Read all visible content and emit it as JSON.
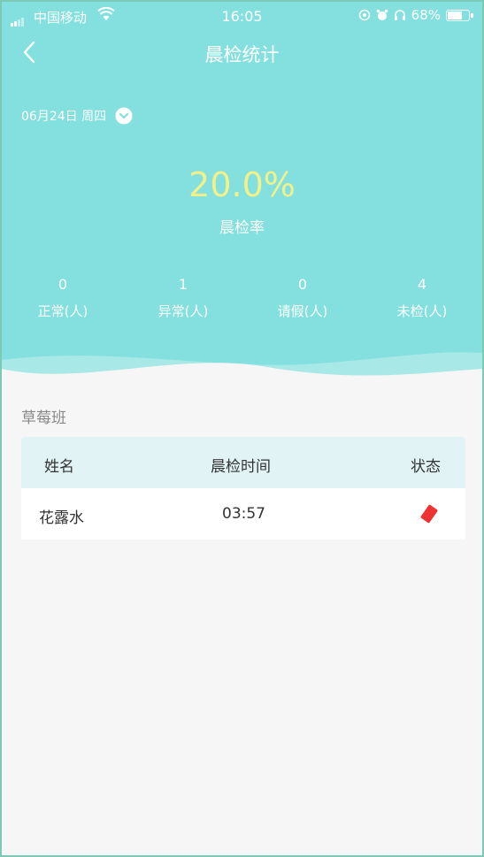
{
  "status_bar": {
    "carrier": "中国移动",
    "time": "16:05",
    "battery": "68%",
    "battery_level": 0.68
  },
  "nav": {
    "title": "晨检统计"
  },
  "date_selector": {
    "label": "06月24日 周四"
  },
  "summary": {
    "rate": "20.0%",
    "rate_label": "晨检率",
    "stats": [
      {
        "value": "0",
        "label": "正常(人)"
      },
      {
        "value": "1",
        "label": "异常(人)"
      },
      {
        "value": "0",
        "label": "请假(人)"
      },
      {
        "value": "4",
        "label": "未检(人)"
      }
    ]
  },
  "class": {
    "name": "草莓班",
    "columns": [
      "姓名",
      "晨检时间",
      "状态"
    ],
    "rows": [
      {
        "name": "花露水",
        "time": "03:57",
        "status_icon": "red-card-icon"
      }
    ]
  },
  "colors": {
    "header_bg": "#84e0df",
    "rate_text": "#f2f08a",
    "table_head_bg": "#e1f3f5",
    "status_red": "#ee3333"
  }
}
